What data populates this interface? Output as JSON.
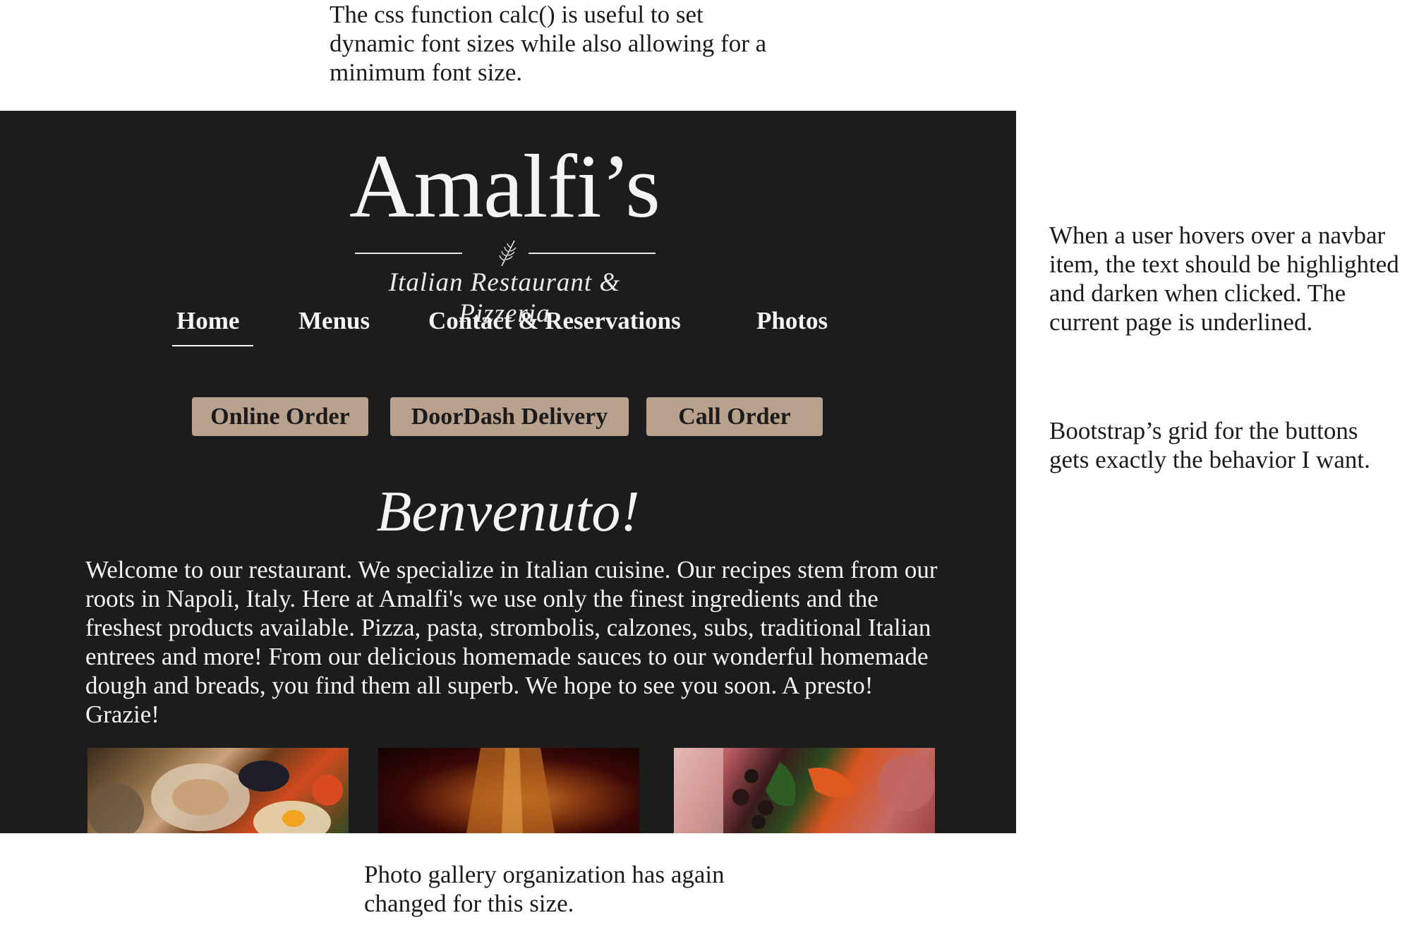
{
  "notes": {
    "top": "The css function calc() is useful to set dynamic font sizes while also allowing for a minimum font size.",
    "right_1": "When a user hovers over a navbar item, the text should be highlighted and darken when clicked. The current page is underlined.",
    "right_2": "Bootstrap’s grid for the buttons gets exactly the behavior I want.",
    "bottom": "Photo gallery organization has again changed for this size."
  },
  "site": {
    "logo": {
      "name": "Amalfi’s",
      "tagline": "Italian Restaurant & Pizzeria"
    },
    "nav": {
      "items": [
        {
          "label": "Home",
          "current": true
        },
        {
          "label": "Menus",
          "current": false
        },
        {
          "label": "Contact & Reservations",
          "current": false
        },
        {
          "label": "Photos",
          "current": false
        }
      ]
    },
    "order_buttons": [
      {
        "label": "Online Order"
      },
      {
        "label": "DoorDash Delivery"
      },
      {
        "label": "Call Order"
      }
    ],
    "welcome": {
      "title": "Benvenuto!",
      "text": "Welcome to our restaurant. We specialize in Italian cuisine. Our recipes stem from our roots in Napoli, Italy.  Here at Amalfi's we use only the finest ingredients and the freshest products available.  Pizza, pasta, strombolis, calzones, subs, traditional Italian entrees and more! From our delicious homemade sauces to our wonderful homemade dough and breads, you find them all superb.  We hope to see you soon.  A presto!  Grazie!"
    },
    "gallery": [
      "seafood-photo",
      "wine-photo",
      "antipasto-photo"
    ]
  },
  "colors": {
    "background": "#1c1c1c",
    "button": "#b9a28d",
    "text_light": "#f4f4f4",
    "text_dark": "#1b1b1b"
  }
}
